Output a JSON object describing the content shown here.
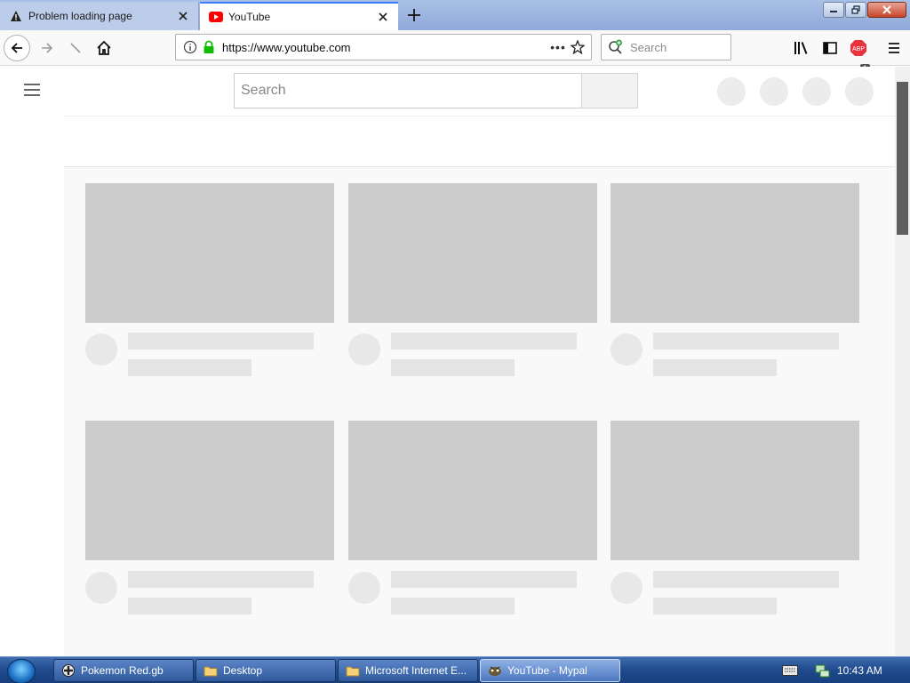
{
  "browser": {
    "tabs": [
      {
        "title": "Problem loading page",
        "icon": "warning-icon",
        "active": false
      },
      {
        "title": "YouTube",
        "icon": "youtube-icon",
        "active": true
      }
    ],
    "url": "https://www.youtube.com",
    "search_placeholder": "Search",
    "adblock_badge": "1"
  },
  "page": {
    "search_placeholder": "Search"
  },
  "taskbar": {
    "items": [
      {
        "label": "Pokemon Red.gb",
        "icon": "emulator-icon"
      },
      {
        "label": "Desktop",
        "icon": "folder-icon"
      },
      {
        "label": "Microsoft Internet E...",
        "icon": "folder-icon"
      },
      {
        "label": "YouTube - Mypal",
        "icon": "mypal-browser-icon",
        "active": true
      }
    ],
    "clock": "10:43 AM"
  },
  "colors": {
    "tab_accent": "#3b7cff",
    "placeholder_gray": "#cccccc",
    "secure_lock": "#12bc00",
    "youtube_red": "#ff0000"
  }
}
